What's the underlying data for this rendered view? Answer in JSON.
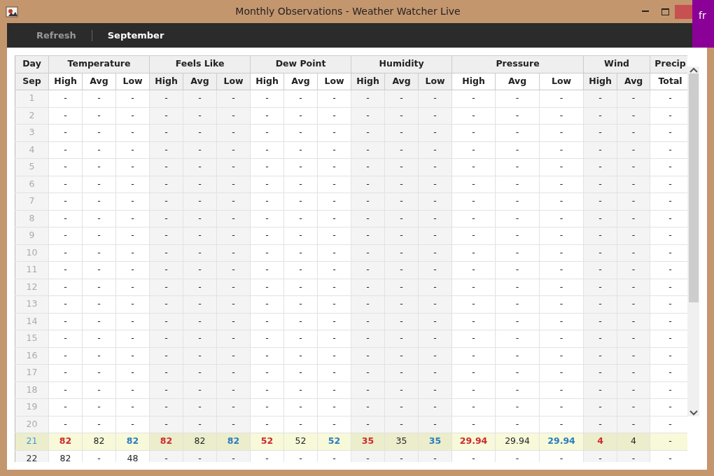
{
  "window": {
    "title": "Monthly Observations - Weather Watcher Live"
  },
  "side_banner": {
    "text": "fr"
  },
  "toolbar": [
    {
      "label": "Refresh",
      "selected": false
    },
    {
      "label": "September",
      "selected": true
    }
  ],
  "table": {
    "groups": [
      {
        "label": "Day",
        "columns": [
          {
            "label": "Sep",
            "kind": "day"
          }
        ]
      },
      {
        "label": "Temperature",
        "columns": [
          {
            "label": "High",
            "kind": "high"
          },
          {
            "label": "Avg",
            "kind": "avg"
          },
          {
            "label": "Low",
            "kind": "low"
          }
        ]
      },
      {
        "label": "Feels Like",
        "columns": [
          {
            "label": "High",
            "kind": "high"
          },
          {
            "label": "Avg",
            "kind": "avg"
          },
          {
            "label": "Low",
            "kind": "low"
          }
        ]
      },
      {
        "label": "Dew Point",
        "columns": [
          {
            "label": "High",
            "kind": "high"
          },
          {
            "label": "Avg",
            "kind": "avg"
          },
          {
            "label": "Low",
            "kind": "low"
          }
        ]
      },
      {
        "label": "Humidity",
        "columns": [
          {
            "label": "High",
            "kind": "high"
          },
          {
            "label": "Avg",
            "kind": "avg"
          },
          {
            "label": "Low",
            "kind": "low"
          }
        ]
      },
      {
        "label": "Pressure",
        "columns": [
          {
            "label": "High",
            "kind": "high"
          },
          {
            "label": "Avg",
            "kind": "avg"
          },
          {
            "label": "Low",
            "kind": "low"
          }
        ]
      },
      {
        "label": "Wind",
        "columns": [
          {
            "label": "High",
            "kind": "high"
          },
          {
            "label": "Avg",
            "kind": "avg"
          }
        ]
      },
      {
        "label": "Precip",
        "columns": [
          {
            "label": "Total",
            "kind": "total"
          }
        ]
      }
    ],
    "rows": [
      {
        "kind": "past",
        "cells": [
          "1",
          "-",
          "-",
          "-",
          "-",
          "-",
          "-",
          "-",
          "-",
          "-",
          "-",
          "-",
          "-",
          "-",
          "-",
          "-",
          "-",
          "-",
          "-"
        ]
      },
      {
        "kind": "past",
        "cells": [
          "2",
          "-",
          "-",
          "-",
          "-",
          "-",
          "-",
          "-",
          "-",
          "-",
          "-",
          "-",
          "-",
          "-",
          "-",
          "-",
          "-",
          "-",
          "-"
        ]
      },
      {
        "kind": "past",
        "cells": [
          "3",
          "-",
          "-",
          "-",
          "-",
          "-",
          "-",
          "-",
          "-",
          "-",
          "-",
          "-",
          "-",
          "-",
          "-",
          "-",
          "-",
          "-",
          "-"
        ]
      },
      {
        "kind": "past",
        "cells": [
          "4",
          "-",
          "-",
          "-",
          "-",
          "-",
          "-",
          "-",
          "-",
          "-",
          "-",
          "-",
          "-",
          "-",
          "-",
          "-",
          "-",
          "-",
          "-"
        ]
      },
      {
        "kind": "past",
        "cells": [
          "5",
          "-",
          "-",
          "-",
          "-",
          "-",
          "-",
          "-",
          "-",
          "-",
          "-",
          "-",
          "-",
          "-",
          "-",
          "-",
          "-",
          "-",
          "-"
        ]
      },
      {
        "kind": "past",
        "cells": [
          "6",
          "-",
          "-",
          "-",
          "-",
          "-",
          "-",
          "-",
          "-",
          "-",
          "-",
          "-",
          "-",
          "-",
          "-",
          "-",
          "-",
          "-",
          "-"
        ]
      },
      {
        "kind": "past",
        "cells": [
          "7",
          "-",
          "-",
          "-",
          "-",
          "-",
          "-",
          "-",
          "-",
          "-",
          "-",
          "-",
          "-",
          "-",
          "-",
          "-",
          "-",
          "-",
          "-"
        ]
      },
      {
        "kind": "past",
        "cells": [
          "8",
          "-",
          "-",
          "-",
          "-",
          "-",
          "-",
          "-",
          "-",
          "-",
          "-",
          "-",
          "-",
          "-",
          "-",
          "-",
          "-",
          "-",
          "-"
        ]
      },
      {
        "kind": "past",
        "cells": [
          "9",
          "-",
          "-",
          "-",
          "-",
          "-",
          "-",
          "-",
          "-",
          "-",
          "-",
          "-",
          "-",
          "-",
          "-",
          "-",
          "-",
          "-",
          "-"
        ]
      },
      {
        "kind": "past",
        "cells": [
          "10",
          "-",
          "-",
          "-",
          "-",
          "-",
          "-",
          "-",
          "-",
          "-",
          "-",
          "-",
          "-",
          "-",
          "-",
          "-",
          "-",
          "-",
          "-"
        ]
      },
      {
        "kind": "past",
        "cells": [
          "11",
          "-",
          "-",
          "-",
          "-",
          "-",
          "-",
          "-",
          "-",
          "-",
          "-",
          "-",
          "-",
          "-",
          "-",
          "-",
          "-",
          "-",
          "-"
        ]
      },
      {
        "kind": "past",
        "cells": [
          "12",
          "-",
          "-",
          "-",
          "-",
          "-",
          "-",
          "-",
          "-",
          "-",
          "-",
          "-",
          "-",
          "-",
          "-",
          "-",
          "-",
          "-",
          "-"
        ]
      },
      {
        "kind": "past",
        "cells": [
          "13",
          "-",
          "-",
          "-",
          "-",
          "-",
          "-",
          "-",
          "-",
          "-",
          "-",
          "-",
          "-",
          "-",
          "-",
          "-",
          "-",
          "-",
          "-"
        ]
      },
      {
        "kind": "past",
        "cells": [
          "14",
          "-",
          "-",
          "-",
          "-",
          "-",
          "-",
          "-",
          "-",
          "-",
          "-",
          "-",
          "-",
          "-",
          "-",
          "-",
          "-",
          "-",
          "-"
        ]
      },
      {
        "kind": "past",
        "cells": [
          "15",
          "-",
          "-",
          "-",
          "-",
          "-",
          "-",
          "-",
          "-",
          "-",
          "-",
          "-",
          "-",
          "-",
          "-",
          "-",
          "-",
          "-",
          "-"
        ]
      },
      {
        "kind": "past",
        "cells": [
          "16",
          "-",
          "-",
          "-",
          "-",
          "-",
          "-",
          "-",
          "-",
          "-",
          "-",
          "-",
          "-",
          "-",
          "-",
          "-",
          "-",
          "-",
          "-"
        ]
      },
      {
        "kind": "past",
        "cells": [
          "17",
          "-",
          "-",
          "-",
          "-",
          "-",
          "-",
          "-",
          "-",
          "-",
          "-",
          "-",
          "-",
          "-",
          "-",
          "-",
          "-",
          "-",
          "-"
        ]
      },
      {
        "kind": "past",
        "cells": [
          "18",
          "-",
          "-",
          "-",
          "-",
          "-",
          "-",
          "-",
          "-",
          "-",
          "-",
          "-",
          "-",
          "-",
          "-",
          "-",
          "-",
          "-",
          "-"
        ]
      },
      {
        "kind": "past",
        "cells": [
          "19",
          "-",
          "-",
          "-",
          "-",
          "-",
          "-",
          "-",
          "-",
          "-",
          "-",
          "-",
          "-",
          "-",
          "-",
          "-",
          "-",
          "-",
          "-"
        ]
      },
      {
        "kind": "past",
        "cells": [
          "20",
          "-",
          "-",
          "-",
          "-",
          "-",
          "-",
          "-",
          "-",
          "-",
          "-",
          "-",
          "-",
          "-",
          "-",
          "-",
          "-",
          "-",
          "-"
        ]
      },
      {
        "kind": "today",
        "cells": [
          "21",
          "82",
          "82",
          "82",
          "82",
          "82",
          "82",
          "52",
          "52",
          "52",
          "35",
          "35",
          "35",
          "29.94",
          "29.94",
          "29.94",
          "4",
          "4",
          "-"
        ]
      },
      {
        "kind": "future",
        "cells": [
          "22",
          "82",
          "-",
          "48",
          "-",
          "-",
          "-",
          "-",
          "-",
          "-",
          "-",
          "-",
          "-",
          "-",
          "-",
          "-",
          "-",
          "-",
          "-"
        ]
      }
    ]
  }
}
